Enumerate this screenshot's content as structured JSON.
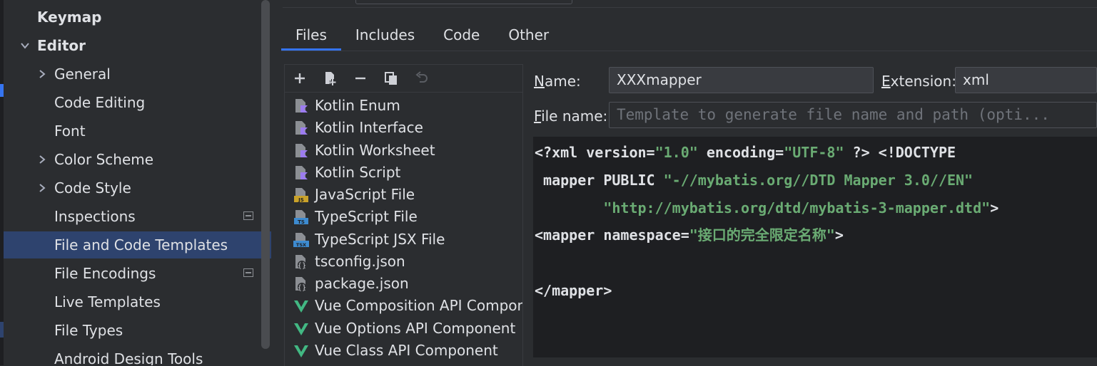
{
  "sidebar": {
    "items": [
      {
        "label": "Keymap",
        "bold": true
      },
      {
        "label": "Editor",
        "bold": true,
        "expanded": true
      },
      {
        "label": "General"
      },
      {
        "label": "Code Editing"
      },
      {
        "label": "Font"
      },
      {
        "label": "Color Scheme"
      },
      {
        "label": "Code Style"
      },
      {
        "label": "Inspections"
      },
      {
        "label": "File and Code Templates",
        "selected": true
      },
      {
        "label": "File Encodings"
      },
      {
        "label": "Live Templates"
      },
      {
        "label": "File Types"
      },
      {
        "label": "Android Design Tools"
      }
    ]
  },
  "tabs": [
    {
      "label": "Files",
      "active": true
    },
    {
      "label": "Includes"
    },
    {
      "label": "Code"
    },
    {
      "label": "Other"
    }
  ],
  "toolbar": {
    "add": "add-icon",
    "copy_new": "create-copy-icon",
    "remove": "remove-icon",
    "copy": "copy-icon",
    "reset": "reset-icon"
  },
  "templates": [
    {
      "label": "Kotlin Enum",
      "icon": "kotlin-file-icon"
    },
    {
      "label": "Kotlin Interface",
      "icon": "kotlin-file-icon"
    },
    {
      "label": "Kotlin Worksheet",
      "icon": "kotlin-file-icon"
    },
    {
      "label": "Kotlin Script",
      "icon": "kotlin-file-icon"
    },
    {
      "label": "JavaScript File",
      "icon": "javascript-file-icon",
      "badge": "JS"
    },
    {
      "label": "TypeScript File",
      "icon": "typescript-file-icon",
      "badge": "TS"
    },
    {
      "label": "TypeScript JSX File",
      "icon": "tsx-file-icon",
      "badge": "TSX"
    },
    {
      "label": "tsconfig.json",
      "icon": "json-file-icon"
    },
    {
      "label": "package.json",
      "icon": "json-file-icon"
    },
    {
      "label": "Vue Composition API Component",
      "icon": "vue-icon"
    },
    {
      "label": "Vue Options API Component",
      "icon": "vue-icon"
    },
    {
      "label": "Vue Class API Component",
      "icon": "vue-icon"
    }
  ],
  "form": {
    "name_label_mnemonic": "N",
    "name_label_rest": "ame:",
    "name_value": "XXXmapper",
    "extension_label_mnemonic": "E",
    "extension_label_rest": "xtension:",
    "extension_value": "xml",
    "filename_label_mnemonic": "F",
    "filename_label_rest": "ile name:",
    "filename_placeholder": "Template to generate file name and path (opti..."
  },
  "editor": {
    "lines": [
      [
        {
          "t": "<?xml version="
        },
        {
          "t": "\"1.0\"",
          "s": true
        },
        {
          "t": " encoding="
        },
        {
          "t": "\"UTF-8\"",
          "s": true
        },
        {
          "t": " ?> <!DOCTYPE"
        }
      ],
      [
        {
          "t": " mapper PUBLIC "
        },
        {
          "t": "\"-//mybatis.org//DTD Mapper 3.0//EN\"",
          "s": true
        }
      ],
      [
        {
          "t": "        "
        },
        {
          "t": "\"http://mybatis.org/dtd/mybatis-3-mapper.dtd\"",
          "s": true
        },
        {
          "t": ">"
        }
      ],
      [
        {
          "t": "<mapper namespace="
        },
        {
          "t": "\"接口的完全限定名称\"",
          "s": true
        },
        {
          "t": ">"
        }
      ],
      [
        {
          "t": ""
        }
      ],
      [
        {
          "t": "</mapper>"
        }
      ]
    ]
  },
  "colors": {
    "background": "#2b2d30",
    "selection": "#2e436e",
    "accent": "#3574f0",
    "editor_bg": "#1e1f22",
    "string": "#6aab73",
    "kotlin": "#9c7cf0",
    "js": "#c9a22a",
    "ts": "#3d8bd0",
    "vue": "#42b883"
  }
}
